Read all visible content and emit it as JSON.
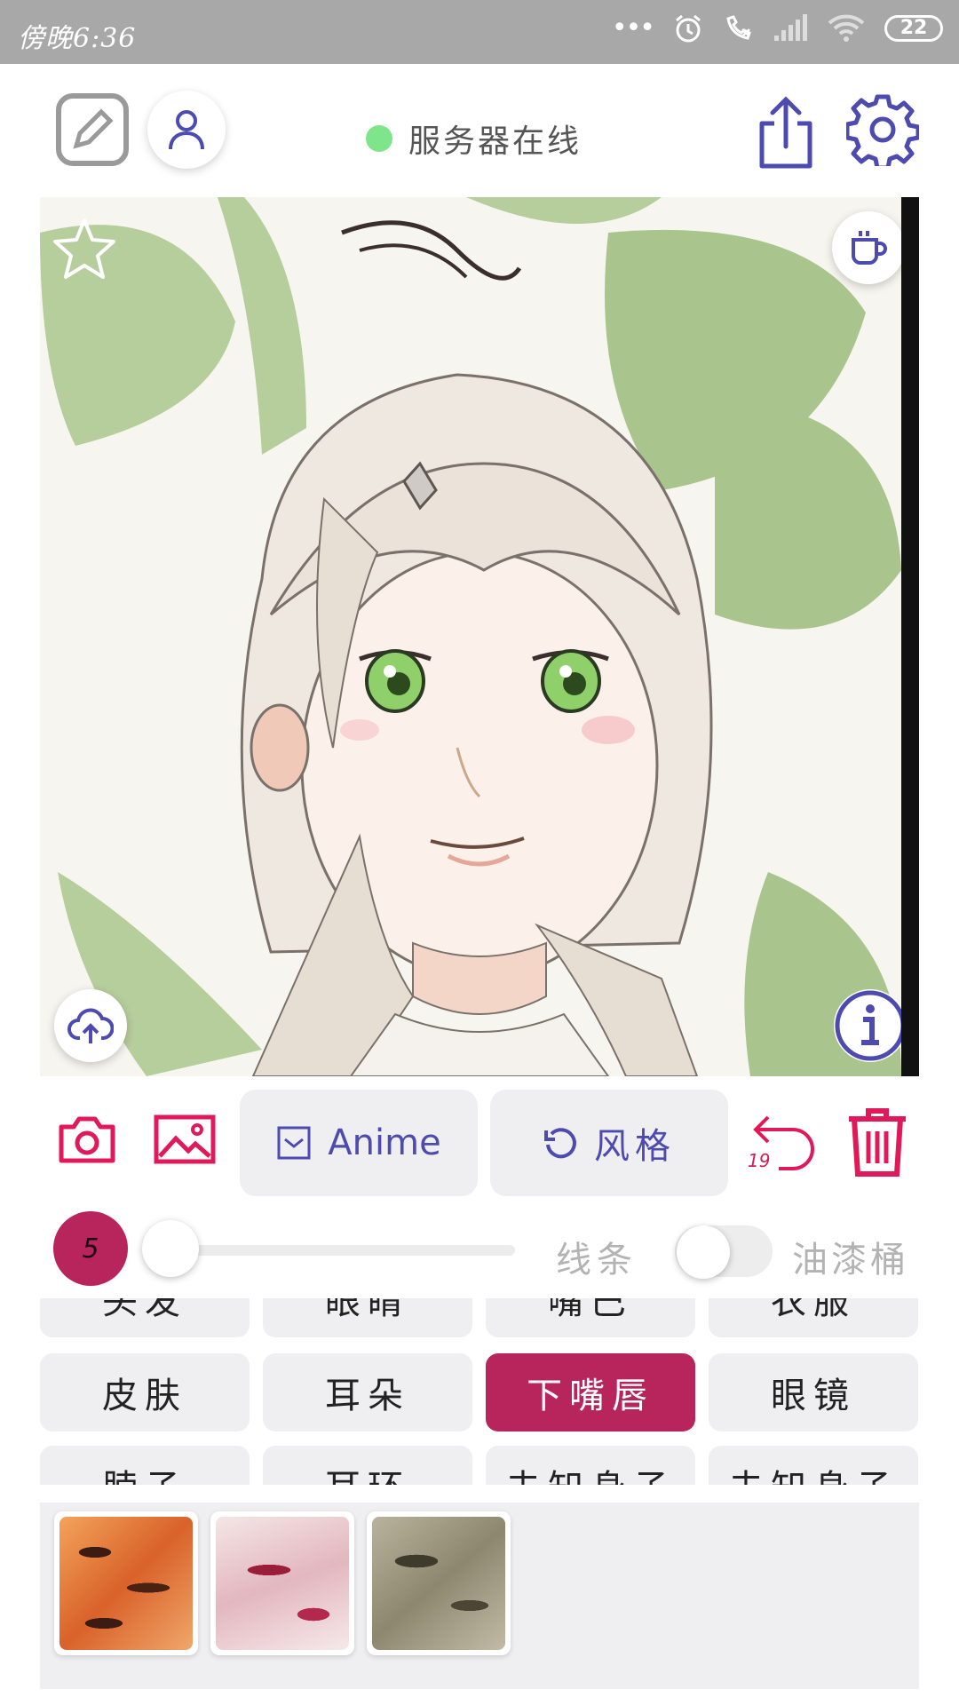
{
  "status_bar": {
    "time": "傍晚6:36",
    "battery": "22"
  },
  "header": {
    "server_status": "服务器在线",
    "server_status_color": "#7fe58a"
  },
  "toolbar": {
    "mode_label": "Anime",
    "style_label": "风格",
    "undo_count": "19"
  },
  "controls": {
    "brush_size": "5",
    "line_label": "线条",
    "paint_label": "油漆桶",
    "slider_value": 0,
    "toggle_on": false
  },
  "parts": {
    "row_top": [
      "头发",
      "眼睛",
      "嘴巴",
      "衣服"
    ],
    "row_main": [
      "皮肤",
      "耳朵",
      "下嘴唇",
      "眼镜"
    ],
    "row_bottom": [
      "脖子",
      "耳环",
      "未知身子",
      "未知身子"
    ],
    "selected": "下嘴唇"
  },
  "colors": {
    "accent": "#b8245c",
    "primary_icon": "#4d4ab0",
    "danger": "#e0195a"
  },
  "swatches": [
    "orange-tiger-texture",
    "crimson-marble-texture",
    "olive-camo-texture"
  ]
}
